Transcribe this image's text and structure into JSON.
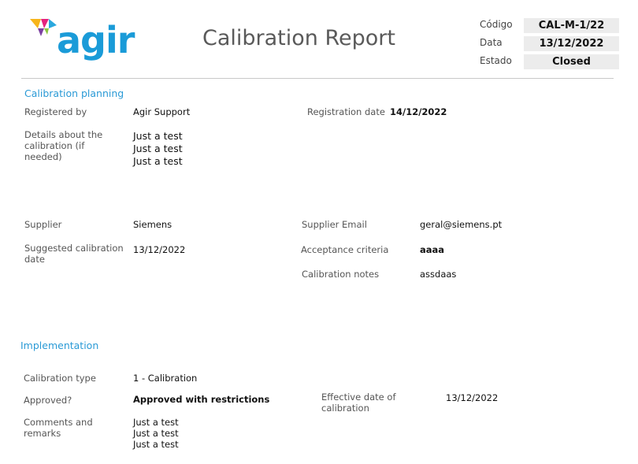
{
  "header": {
    "logo_text": "agir",
    "title": "Calibration Report",
    "meta": [
      {
        "label": "Código",
        "value": "CAL-M-1/22"
      },
      {
        "label": "Data",
        "value": "13/12/2022"
      },
      {
        "label": "Estado",
        "value": "Closed"
      }
    ]
  },
  "planning": {
    "section_title": "Calibration planning",
    "registered_by_label": "Registered by",
    "registered_by_value": "Agir Support",
    "registration_date_label": "Registration date",
    "registration_date_value": "14/12/2022",
    "details_label": [
      "Details about the",
      "calibration (if",
      "needed)"
    ],
    "details_value": [
      "Just a test",
      "Just a test",
      "Just a test"
    ],
    "supplier_label": "Supplier",
    "supplier_value": "Siemens",
    "supplier_email_label": "Supplier Email",
    "supplier_email_value": "geral@siemens.pt",
    "suggested_date_label": [
      "Suggested calibration",
      "date"
    ],
    "suggested_date_value": "13/12/2022",
    "acceptance_label": "Acceptance criteria",
    "acceptance_value": "aaaa",
    "notes_label": "Calibration notes",
    "notes_value": "assdaas"
  },
  "implementation": {
    "section_title": "Implementation",
    "type_label": "Calibration type",
    "type_value": "1 - Calibration",
    "approved_label": "Approved?",
    "approved_value": "Approved with restrictions",
    "effective_label": [
      "Effective date of",
      "calibration"
    ],
    "effective_value": "13/12/2022",
    "comments_label": [
      "Comments and",
      "remarks"
    ],
    "comments_value": [
      "Just a test",
      "Just a test",
      "Just a test"
    ]
  }
}
